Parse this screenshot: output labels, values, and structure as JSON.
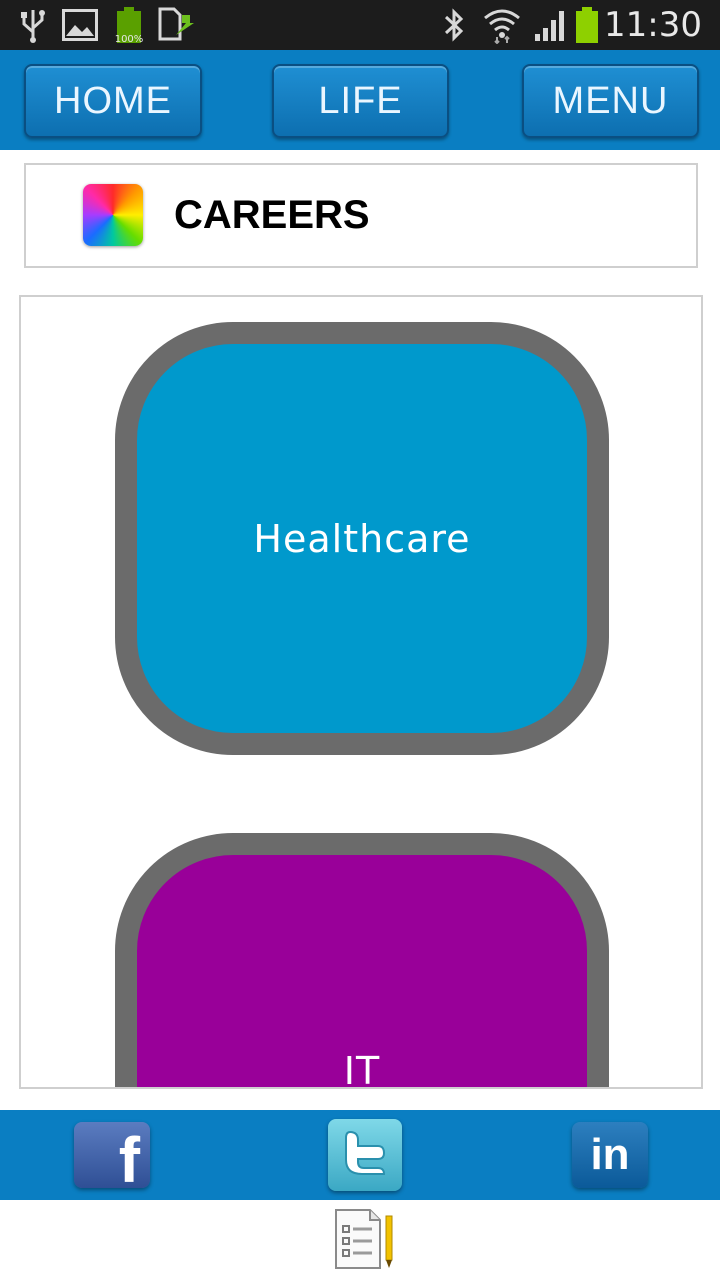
{
  "status_bar": {
    "battery_small_label": "100%",
    "time": "11:30"
  },
  "nav": {
    "home_label": "HOME",
    "life_label": "LIFE",
    "menu_label": "MENU"
  },
  "header": {
    "title": "CAREERS"
  },
  "careers": [
    {
      "label": "Healthcare",
      "color": "#0099cc"
    },
    {
      "label": "IT",
      "color": "#990099"
    }
  ],
  "social": {
    "facebook_glyph": "f",
    "linkedin_glyph": "in"
  },
  "colors": {
    "bar_blue": "#0a7ec2",
    "tile_border": "#6b6b6b"
  },
  "icons": [
    "usb-icon",
    "image-icon",
    "battery-small-icon",
    "download-icon",
    "bluetooth-icon",
    "wifi-icon",
    "signal-icon",
    "battery-icon",
    "app-logo-icon",
    "facebook-icon",
    "twitter-icon",
    "linkedin-icon",
    "notes-icon"
  ]
}
